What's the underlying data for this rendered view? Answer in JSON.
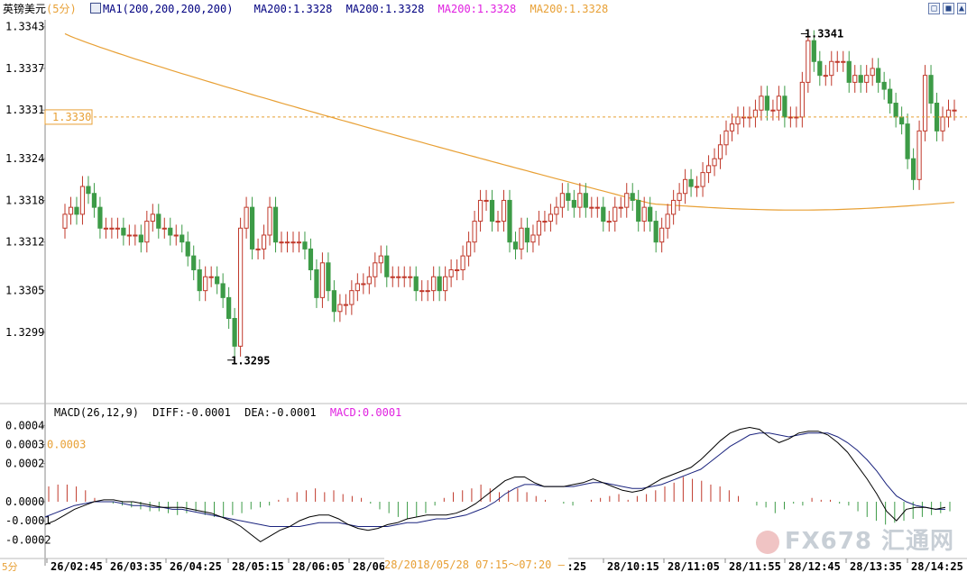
{
  "header": {
    "symbol": "英镑美元",
    "period": "(5分)",
    "ma_def": "MA1(200,200,200,200)",
    "ma_values": [
      {
        "text": "MA200:1.3328",
        "color": "#000080"
      },
      {
        "text": "MA200:1.3328",
        "color": "#000080"
      },
      {
        "text": "MA200:1.3328",
        "color": "#e020e0"
      },
      {
        "text": "MA200:1.3328",
        "color": "#e8a035"
      }
    ]
  },
  "macd_header": {
    "def": "MACD(26,12,9)",
    "diff": "DIFF:-0.0001",
    "dea": "DEA:-0.0001",
    "macd": "MACD:0.0001"
  },
  "controls": {
    "btn1": "□",
    "btn2": "■",
    "btn3": "▲"
  },
  "current_price_tag": "1.3330",
  "macd_tag": "0.0003",
  "annotations": {
    "high": "1.3341",
    "low": "1.3295"
  },
  "time_tooltip": "28/2018/05/28  07:15～07:20  —",
  "period_corner": "5分",
  "watermark": "FX678 汇通网",
  "colors": {
    "up": "#c0392b",
    "down": "#3d9b47",
    "ma": "#e8a035",
    "diff": "#000000",
    "dea": "#1a237e",
    "grid": "#e0e0e0"
  },
  "chart_data": [
    {
      "type": "candlestick",
      "title": "英镑美元(5分)",
      "y_ticks": [
        "1.3343",
        "1.3337",
        "1.3331",
        "1.3324",
        "1.3318",
        "1.3312",
        "1.3305",
        "1.3299"
      ],
      "x_ticks": [
        "26/02:45",
        "26/03:35",
        "26/04:25",
        "28/05:15",
        "28/06:05",
        "28/06:",
        "09:25",
        "28/10:15",
        "28/11:05",
        "28/11:55",
        "28/12:45",
        "28/13:35",
        "28/14:25"
      ],
      "ylim": [
        1.3289,
        1.3344
      ],
      "current_price": 1.333,
      "high": 1.3341,
      "low": 1.3295,
      "close": [
        1.3316,
        1.3317,
        1.3316,
        1.332,
        1.3319,
        1.3317,
        1.3314,
        1.3314,
        1.3314,
        1.3314,
        1.3313,
        1.3313,
        1.3313,
        1.3312,
        1.3315,
        1.3316,
        1.3314,
        1.3314,
        1.3313,
        1.3313,
        1.3312,
        1.331,
        1.3308,
        1.3305,
        1.3307,
        1.3307,
        1.3306,
        1.3304,
        1.3301,
        1.3297,
        1.3314,
        1.3317,
        1.3311,
        1.3311,
        1.3313,
        1.3317,
        1.3312,
        1.3312,
        1.3312,
        1.3312,
        1.3312,
        1.3311,
        1.3308,
        1.3304,
        1.3309,
        1.3305,
        1.3302,
        1.3303,
        1.3303,
        1.3305,
        1.3306,
        1.3306,
        1.3307,
        1.3309,
        1.331,
        1.3307,
        1.3307,
        1.3307,
        1.3307,
        1.3307,
        1.3305,
        1.3305,
        1.3305,
        1.3307,
        1.3305,
        1.3307,
        1.3308,
        1.3308,
        1.331,
        1.3312,
        1.3315,
        1.3318,
        1.3318,
        1.3315,
        1.3315,
        1.3318,
        1.3312,
        1.3311,
        1.3314,
        1.3312,
        1.3313,
        1.3315,
        1.3315,
        1.3316,
        1.3317,
        1.3319,
        1.3318,
        1.3317,
        1.3319,
        1.3317,
        1.3317,
        1.3317,
        1.3315,
        1.3315,
        1.3317,
        1.3317,
        1.3319,
        1.3318,
        1.3315,
        1.3317,
        1.3315,
        1.3312,
        1.3314,
        1.3316,
        1.3318,
        1.3319,
        1.3321,
        1.332,
        1.332,
        1.3322,
        1.3323,
        1.3324,
        1.3326,
        1.3328,
        1.3329,
        1.333,
        1.333,
        1.333,
        1.3331,
        1.3333,
        1.3331,
        1.3331,
        1.3333,
        1.333,
        1.333,
        1.333,
        1.3335,
        1.3341,
        1.3338,
        1.3336,
        1.3336,
        1.3338,
        1.3338,
        1.3338,
        1.3335,
        1.3336,
        1.3335,
        1.3336,
        1.3337,
        1.3335,
        1.3334,
        1.3332,
        1.333,
        1.3329,
        1.3324,
        1.3321,
        1.3328,
        1.3336,
        1.3332,
        1.3328,
        1.333,
        1.3331,
        1.3331
      ]
    },
    {
      "type": "macd",
      "title": "MACD(26,12,9)",
      "y_ticks": [
        "0.0004",
        "0.0003",
        "0.0002",
        "0.0000",
        "-0.0001",
        "-0.0002"
      ],
      "ylim": [
        -0.00026,
        0.00043
      ],
      "diff": [
        -0.00012,
        -0.0001,
        -7e-05,
        -4e-05,
        -2e-05,
        0.0,
        1e-05,
        1e-05,
        0.0,
        0.0,
        -1e-05,
        -2e-05,
        -3e-05,
        -3e-05,
        -3e-05,
        -4e-05,
        -5e-05,
        -6e-05,
        -8e-05,
        -0.0001,
        -0.00013,
        -0.00017,
        -0.00021,
        -0.00018,
        -0.00015,
        -0.00013,
        -0.0001,
        -8e-05,
        -7e-05,
        -7e-05,
        -9e-05,
        -0.00012,
        -0.00014,
        -0.00015,
        -0.00014,
        -0.00012,
        -0.00011,
        -9e-05,
        -8e-05,
        -7e-05,
        -7e-05,
        -7e-05,
        -6e-05,
        -4e-05,
        -1e-05,
        3e-05,
        7e-05,
        0.00011,
        0.00013,
        0.00013,
        0.0001,
        8e-05,
        8e-05,
        8e-05,
        9e-05,
        0.0001,
        0.00012,
        0.0001,
        8e-05,
        6e-05,
        5e-05,
        6e-05,
        9e-05,
        0.00012,
        0.00014,
        0.00016,
        0.00018,
        0.00022,
        0.00027,
        0.00032,
        0.00036,
        0.00038,
        0.00039,
        0.00038,
        0.00034,
        0.00031,
        0.00033,
        0.00036,
        0.00037,
        0.00037,
        0.00035,
        0.00031,
        0.00026,
        0.00019,
        0.00012,
        4e-05,
        -5e-05,
        -0.0001,
        -4e-05,
        -3e-05,
        -3e-05,
        -4e-05,
        -3e-05
      ],
      "dea": [
        -8e-05,
        -6e-05,
        -4e-05,
        -2e-05,
        -1e-05,
        0.0,
        0.0,
        0.0,
        -1e-05,
        -2e-05,
        -2e-05,
        -3e-05,
        -3e-05,
        -4e-05,
        -4e-05,
        -5e-05,
        -6e-05,
        -7e-05,
        -8e-05,
        -9e-05,
        -0.0001,
        -0.00011,
        -0.00012,
        -0.00013,
        -0.00013,
        -0.00013,
        -0.00013,
        -0.00012,
        -0.00011,
        -0.00011,
        -0.00011,
        -0.00012,
        -0.00013,
        -0.00013,
        -0.00013,
        -0.00013,
        -0.00012,
        -0.00011,
        -0.00011,
        -0.0001,
        -9e-05,
        -9e-05,
        -8e-05,
        -7e-05,
        -5e-05,
        -3e-05,
        0.0,
        4e-05,
        7e-05,
        9e-05,
        9e-05,
        8e-05,
        8e-05,
        8e-05,
        8e-05,
        9e-05,
        0.0001,
        0.0001,
        9e-05,
        8e-05,
        7e-05,
        7e-05,
        8e-05,
        9e-05,
        0.00011,
        0.00013,
        0.00015,
        0.00017,
        0.00021,
        0.00025,
        0.00029,
        0.00032,
        0.00035,
        0.00036,
        0.00036,
        0.00035,
        0.00034,
        0.00035,
        0.00036,
        0.00036,
        0.00036,
        0.00034,
        0.00031,
        0.00027,
        0.00022,
        0.00016,
        9e-05,
        3e-05,
        0.0,
        -2e-05,
        -3e-05,
        -4e-05,
        -4e-05
      ],
      "macd": [
        8e-05,
        9e-05,
        9e-05,
        8e-05,
        6e-05,
        2e-05,
        0.0,
        -1e-05,
        -2e-05,
        -3e-05,
        -4e-05,
        -5e-05,
        -5e-05,
        -6e-05,
        -7e-05,
        -6e-05,
        -5e-05,
        -7e-05,
        -8e-05,
        -8e-05,
        -7e-05,
        -6e-05,
        -4e-05,
        -3e-05,
        -2e-05,
        1e-05,
        2e-05,
        5e-05,
        6e-05,
        7e-05,
        5e-05,
        6e-05,
        4e-05,
        3e-05,
        2e-05,
        -1e-05,
        -4e-05,
        -6e-05,
        -8e-05,
        -9e-05,
        -8e-05,
        -6e-05,
        -2e-05,
        2e-05,
        5e-05,
        6e-05,
        7e-05,
        9e-05,
        7e-05,
        5e-05,
        6e-05,
        7e-05,
        5e-05,
        3e-05,
        1e-05,
        0.0,
        -1e-05,
        -2e-05,
        0.0,
        1e-05,
        2e-05,
        3e-05,
        4e-05,
        1e-05,
        3e-05,
        4e-05,
        6e-05,
        8e-05,
        0.0001,
        0.00013,
        0.00012,
        0.00011,
        9e-05,
        8e-05,
        6e-05,
        3e-05,
        0.0,
        -2e-05,
        -3e-05,
        -6e-05,
        -4e-05,
        -1e-05,
        -2e-05,
        2e-05,
        1e-05,
        1e-05,
        -1e-05,
        -2e-05,
        -5e-05,
        -8e-05,
        -0.0001,
        -0.00012,
        -0.00011,
        -0.0001,
        -9e-05,
        -8e-05,
        -7e-05,
        -6e-05,
        -5e-05
      ]
    }
  ]
}
